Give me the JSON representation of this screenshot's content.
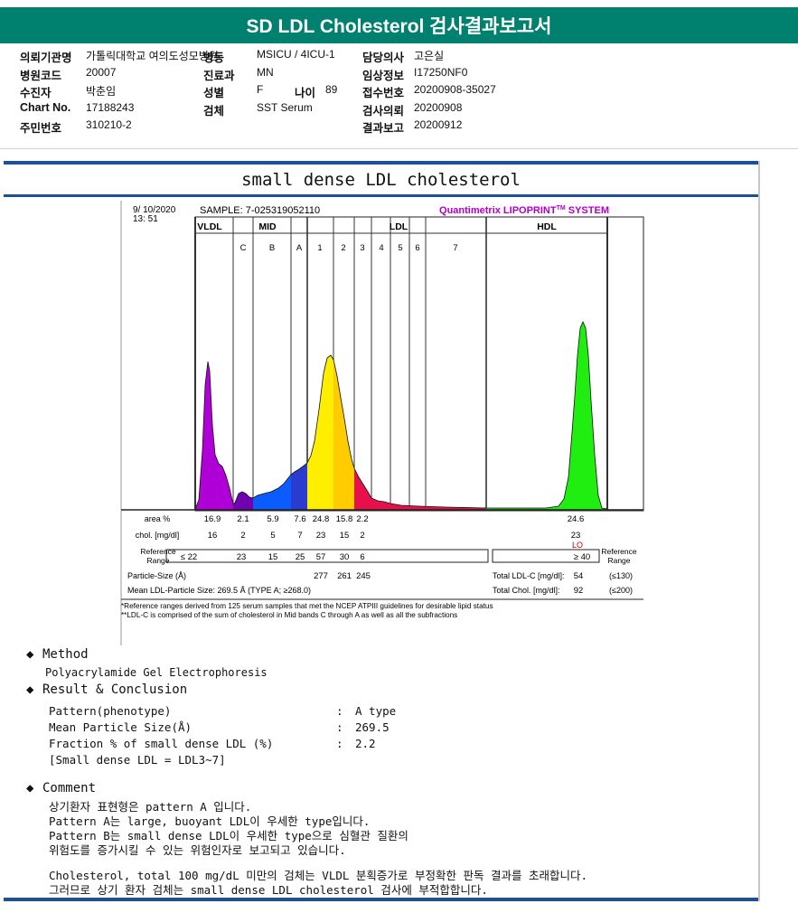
{
  "header": {
    "title": "SD LDL Cholesterol 검사결과보고서"
  },
  "patient": {
    "rows": [
      [
        {
          "label": "의뢰기관명",
          "value": "가톨릭대학교 여의도성모병원"
        },
        {
          "label": "병동",
          "value": "MSICU / 4ICU-1"
        },
        {
          "label": "담당의사",
          "value": "고은실"
        }
      ],
      [
        {
          "label": "병원코드",
          "value": "20007"
        },
        {
          "label": "진료과",
          "value": "MN"
        },
        {
          "label": "임상정보",
          "value": "I17250NF0"
        }
      ],
      [
        {
          "label": "수진자",
          "value": "박춘임"
        },
        {
          "label": "성별",
          "value": "F"
        },
        {
          "label": "접수번호",
          "value": "20200908-35027"
        }
      ],
      [
        {
          "label": "Chart No.",
          "value": "17188243"
        },
        {
          "label": "검체",
          "value": "SST Serum"
        },
        {
          "label": "검사의뢰",
          "value": "20200908"
        }
      ],
      [
        {
          "label": "주민번호",
          "value": "310210-2"
        },
        {
          "label": "",
          "value": ""
        },
        {
          "label": "결과보고",
          "value": "20200912"
        }
      ]
    ],
    "age_label": "나이",
    "age_value": "89"
  },
  "report": {
    "subtitle": "small dense LDL cholesterol"
  },
  "chart_data": {
    "type": "area",
    "date": "9/ 10/2020",
    "time": "13: 51",
    "sample": "SAMPLE:  7-025319052110",
    "system": "Quantimetrix LIPOPRINT",
    "system_tm": "TM",
    "system_suffix": " SYSTEM",
    "group_labels": [
      "VLDL",
      "MID",
      "LDL",
      "HDL"
    ],
    "band_labels": [
      "C",
      "B",
      "A",
      "1",
      "2",
      "3",
      "4",
      "5",
      "6",
      "7"
    ],
    "area_label": "area %",
    "area_values": [
      "16.9",
      "2.1",
      "5.9",
      "7.6",
      "24.8",
      "15.8",
      "2.2",
      "24.6"
    ],
    "chol_label": "chol. [mg/dl]",
    "chol_values": [
      "16",
      "2",
      "5",
      "7",
      "23",
      "15",
      "2",
      "23"
    ],
    "hdl_flag": "LO",
    "reference_label": [
      "Reference",
      "Range"
    ],
    "reference_values": [
      "≤ 22",
      "23",
      "15",
      "25",
      "57",
      "30",
      "6"
    ],
    "hdl_reference": "≥ 40",
    "particle_size_label": "Particle-Size (Å)",
    "particle_sizes": [
      "277",
      "261",
      "245"
    ],
    "mean_size_label": "Mean LDL-Particle Size:   269.5 Å   (TYPE A; ≥268.0)",
    "total_ldl_label": "Total LDL-C [mg/dl]:",
    "total_ldl_value": "54",
    "total_ldl_ref": "(≤130)",
    "total_chol_label": "Total Chol. [mg/dl]:",
    "total_chol_value": "92",
    "total_chol_ref": "(≤200)",
    "footnote1": "*Reference ranges derived from 125 serum samples that met the NCEP ATPIII guidelines for desirable lipid status",
    "footnote2": "**LDL-C is comprised of the sum of cholesterol in Mid bands C through A as well as all the subfractions",
    "colors": {
      "vldl": "#b000d8",
      "mid_c": "#7000b0",
      "mid_b": "#0a5cff",
      "mid_a": "#2a3cd0",
      "ldl1": "#ffee00",
      "ldl2": "#ffcc00",
      "ldl3": "#e8104a",
      "hdl": "#20ee10",
      "system": "#b000c8"
    }
  },
  "method": {
    "heading": "Method",
    "text": "Polyacrylamide Gel Electrophoresis"
  },
  "result": {
    "heading": "Result & Conclusion",
    "rows": [
      {
        "label": "Pattern(phenotype)",
        "colon": ":",
        "value": "A type"
      },
      {
        "label": "Mean Particle Size(Å)",
        "colon": ":",
        "value": "269.5"
      },
      {
        "label": "Fraction % of small dense LDL (%)",
        "colon": ":",
        "value": "2.2"
      }
    ],
    "note": "[Small dense LDL = LDL3~7]"
  },
  "comment": {
    "heading": "Comment",
    "lines": [
      "상기환자 표현형은 pattern A 입니다.",
      "Pattern A는 large, buoyant LDL이 우세한 type입니다.",
      "Pattern B는 small dense LDL이 우세한 type으로 심혈관 질환의",
      "위험도를 증가시킬 수 있는 위험인자로 보고되고 있습니다.",
      "Cholesterol, total 100 mg/dL 미만의 검체는 VLDL 분획증가로 부정확한 판독 결과를 초래합니다.",
      "그러므로 상기 환자 검체는 small dense LDL cholesterol 검사에 부적합합니다."
    ]
  }
}
